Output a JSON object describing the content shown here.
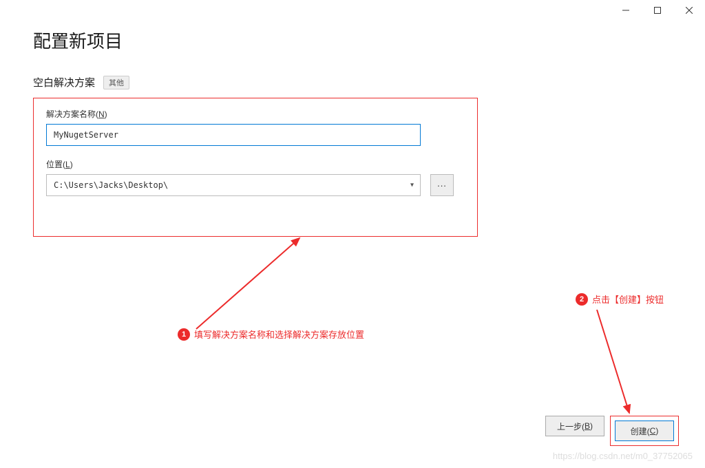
{
  "page_title": "配置新项目",
  "subtitle": "空白解决方案",
  "tag": "其他",
  "fields": {
    "solution_name_label_pre": "解决方案名称(",
    "solution_name_key": "N",
    "solution_name_label_post": ")",
    "solution_name_value": "MyNugetServer",
    "location_label_pre": "位置(",
    "location_key": "L",
    "location_label_post": ")",
    "location_value": "C:\\Users\\Jacks\\Desktop\\"
  },
  "browse_btn": "...",
  "annotations": {
    "a1_num": "1",
    "a1_text": "填写解决方案名称和选择解决方案存放位置",
    "a2_num": "2",
    "a2_text": "点击【创建】按钮"
  },
  "footer": {
    "back_pre": "上一步(",
    "back_key": "B",
    "back_post": ")",
    "create_pre": "创建(",
    "create_key": "C",
    "create_post": ")"
  },
  "watermark": "https://blog.csdn.net/m0_37752065"
}
